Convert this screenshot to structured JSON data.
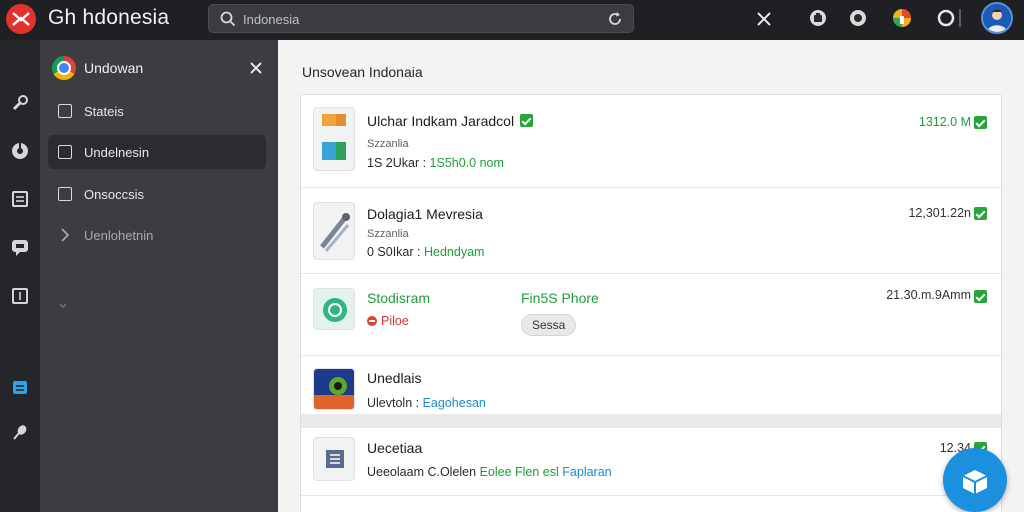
{
  "app": {
    "title": "Gh hdonesia"
  },
  "search": {
    "value": "Indonesia",
    "placeholder": ""
  },
  "sidebar": {
    "header": "Undowan",
    "items": [
      {
        "label": "Stateis"
      },
      {
        "label": "Undelnesin"
      },
      {
        "label": "Onsoccsis"
      },
      {
        "label": "Uenlohetnin"
      }
    ]
  },
  "main": {
    "title": "Unsovean Indonaia",
    "rows": [
      {
        "name": "Ulchar Indkam Jaradcol",
        "sub": "Szzanlia",
        "meta_a": "1S 2Ukar :",
        "meta_b": "1S5h0.0 nom",
        "size": "1312.0 M"
      },
      {
        "name": "Dolagia1 Mevresia",
        "sub": "Szzanlia",
        "meta_a": "0 S0Ikar :",
        "meta_b": "Hedndyam",
        "size": "12,301.22n"
      },
      {
        "name": "Stodisram",
        "status": "Piloe",
        "mid": "Fin5S Phore",
        "button": "Sessa",
        "size": "21.30.m.9Amm"
      },
      {
        "name": "Unedlais",
        "meta_a": "Ulevtoln :",
        "meta_b": "Eagohesan"
      },
      {
        "name": "Uecetiaa",
        "meta_a": "Ueeolaam C.Olelen",
        "meta_b": "Eolee Flen esl",
        "meta_c": "Faplaran",
        "size": "12.34"
      }
    ]
  },
  "colors": {
    "accent": "#1c8fde",
    "success": "#27a53a",
    "danger": "#e0432c",
    "brand": "#e2322d"
  }
}
